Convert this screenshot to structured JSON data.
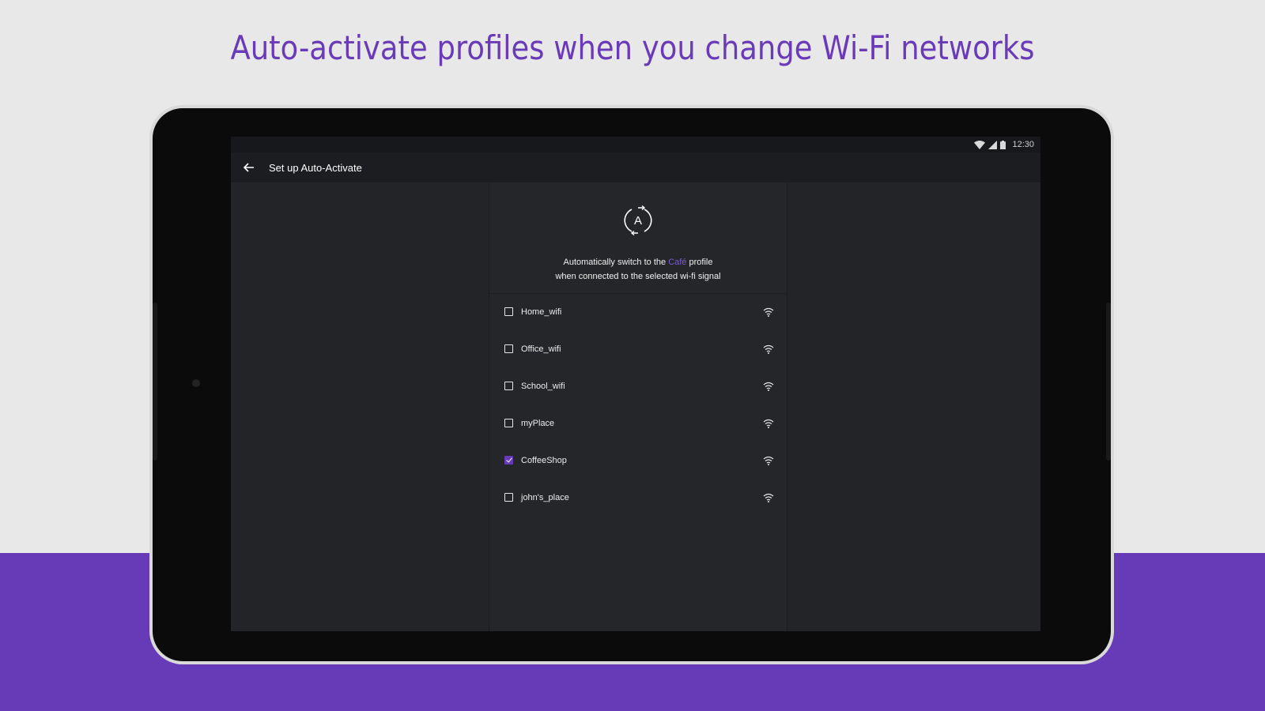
{
  "headline": "Auto-activate profiles when you change Wi-Fi networks",
  "status_bar": {
    "time": "12:30",
    "icons": [
      "wifi-icon",
      "cell-signal-icon",
      "battery-icon"
    ]
  },
  "app_bar": {
    "title": "Set up Auto-Activate",
    "back_icon": "back-arrow-icon"
  },
  "panel": {
    "icon": "auto-activate-icon",
    "icon_letter": "A",
    "description_before": "Automatically switch to the ",
    "profile_name": "Café",
    "description_after": " profile",
    "description_line2": "when connected to the selected wi-fi signal"
  },
  "wifi_networks": [
    {
      "name": "Home_wifi",
      "checked": false
    },
    {
      "name": "Office_wifi",
      "checked": false
    },
    {
      "name": "School_wifi",
      "checked": false
    },
    {
      "name": "myPlace",
      "checked": false
    },
    {
      "name": "CoffeeShop",
      "checked": true
    },
    {
      "name": "john's_place",
      "checked": false
    }
  ],
  "colors": {
    "accent": "#673ab7",
    "headline": "#6a3ab8",
    "background": "#e8e8e9",
    "screen": "#232428"
  }
}
